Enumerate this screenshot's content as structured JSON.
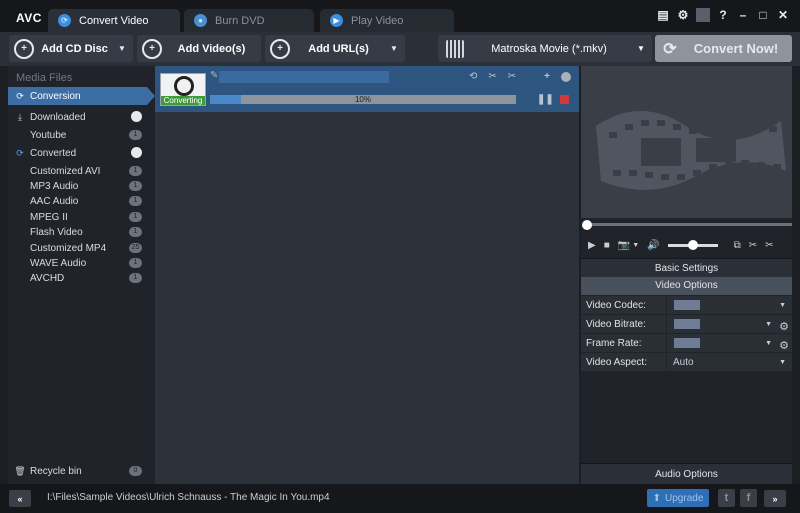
{
  "app": {
    "logo": "AVC"
  },
  "tabs": [
    {
      "label": "Convert Video",
      "active": true
    },
    {
      "label": "Burn DVD",
      "active": false
    },
    {
      "label": "Play Video",
      "active": false
    }
  ],
  "window_controls": {
    "help": "?",
    "minimize": "–",
    "maximize": "□",
    "close": "✕"
  },
  "toolbar": {
    "add_cd": "Add CD Disc",
    "add_video": "Add Video(s)",
    "add_url": "Add URL(s)",
    "format": "Matroska Movie (*.mkv)",
    "convert": "Convert Now!"
  },
  "sidebar": {
    "title": "Media Files",
    "items": [
      {
        "label": "Conversion",
        "icon": "conversion-icon",
        "selected": true
      },
      {
        "label": "Downloaded",
        "icon": "download-icon",
        "badge": ""
      },
      {
        "label": "Youtube",
        "badge": "1"
      },
      {
        "label": "Converted",
        "icon": "refresh-icon",
        "badge": ""
      },
      {
        "label": "Customized AVI",
        "badge": "1"
      },
      {
        "label": "MP3 Audio",
        "badge": "1"
      },
      {
        "label": "AAC Audio",
        "badge": "1"
      },
      {
        "label": "MPEG II",
        "badge": "1"
      },
      {
        "label": "Flash Video",
        "badge": "1"
      },
      {
        "label": "Customized MP4",
        "badge": "25"
      },
      {
        "label": "WAVE Audio",
        "badge": "1"
      },
      {
        "label": "AVCHD",
        "badge": "1"
      }
    ],
    "recycle": {
      "label": "Recycle bin",
      "badge": "0"
    }
  },
  "task": {
    "status": "Converting",
    "progress_text": "10%",
    "progress": 0.1
  },
  "right_panel": {
    "basic_settings": "Basic Settings",
    "video_options": "Video Options",
    "options": [
      {
        "label": "Video Codec:",
        "value": ""
      },
      {
        "label": "Video Bitrate:",
        "value": ""
      },
      {
        "label": "Frame Rate:",
        "value": ""
      },
      {
        "label": "Video Aspect:",
        "value": "Auto"
      }
    ],
    "audio_options": "Audio Options"
  },
  "statusbar": {
    "path": "I:\\Files\\Sample Videos\\Ulrich Schnauss - The Magic In You.mp4",
    "upgrade": "Upgrade"
  },
  "colors": {
    "accent": "#3c6ea4",
    "task_bg": "#2e5580",
    "progress": "#4a88c8",
    "stop": "#d23a3a",
    "converting": "#3f9a3a"
  }
}
